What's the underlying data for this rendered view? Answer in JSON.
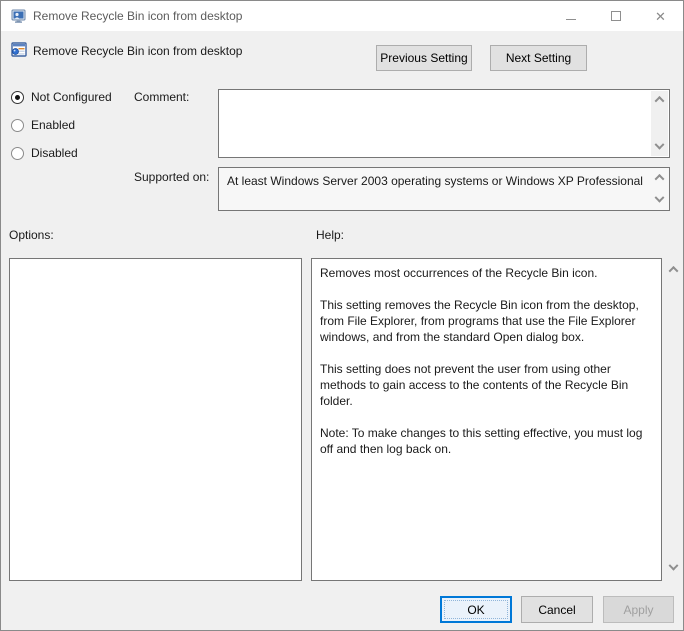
{
  "window": {
    "title": "Remove Recycle Bin icon from desktop",
    "close_glyph": "✕"
  },
  "header": {
    "setting_title": "Remove Recycle Bin icon from desktop",
    "previous_button": "Previous Setting",
    "next_button": "Next Setting"
  },
  "radios": [
    {
      "label": "Not Configured",
      "selected": true
    },
    {
      "label": "Enabled",
      "selected": false
    },
    {
      "label": "Disabled",
      "selected": false
    }
  ],
  "comment": {
    "label": "Comment:",
    "value": ""
  },
  "supported": {
    "label": "Supported on:",
    "value": "At least Windows Server 2003 operating systems or Windows XP Professional"
  },
  "options": {
    "label": "Options:"
  },
  "help": {
    "label": "Help:",
    "paragraphs": [
      "Removes most occurrences of the Recycle Bin icon.",
      "This setting removes the Recycle Bin icon from the desktop, from File Explorer, from programs that use the File Explorer windows, and from the standard Open dialog box.",
      "This setting does not prevent the user from using other methods to gain access to the contents of the Recycle Bin folder.",
      "Note: To make changes to this setting effective, you must log off and then log back on."
    ]
  },
  "footer": {
    "ok_label": "OK",
    "cancel_label": "Cancel",
    "apply_label": "Apply"
  },
  "icons": {
    "app": "group-policy-app-icon",
    "setting": "policy-setting-icon",
    "scroll_up": "chevron-up-icon",
    "scroll_down": "chevron-down-icon"
  },
  "colors": {
    "accent": "#0078d7",
    "dialog_background": "#f0f0f0",
    "titlebar_background": "#ffffff",
    "button_face": "#e1e1e1",
    "button_border": "#adadad",
    "textbox_border": "#767676"
  }
}
